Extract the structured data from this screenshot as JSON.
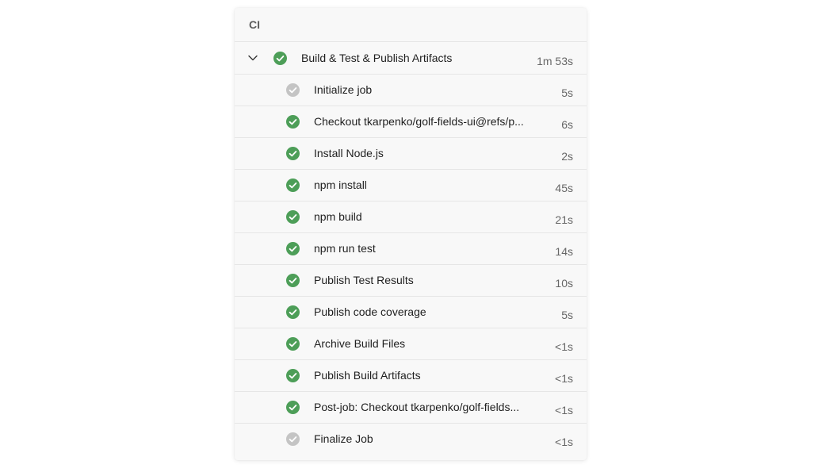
{
  "panel": {
    "title": "CI"
  },
  "colors": {
    "success": "#4d9e58",
    "neutral": "#c4c4c4"
  },
  "job": {
    "label": "Build & Test & Publish Artifacts",
    "duration": "1m 53s",
    "status": "success",
    "expanded": true,
    "icon": "chevron-down-icon"
  },
  "steps": [
    {
      "label": "Initialize job",
      "duration": "5s",
      "status": "neutral"
    },
    {
      "label": "Checkout tkarpenko/golf-fields-ui@refs/p...",
      "duration": "6s",
      "status": "success"
    },
    {
      "label": "Install Node.js",
      "duration": "2s",
      "status": "success"
    },
    {
      "label": "npm install",
      "duration": "45s",
      "status": "success"
    },
    {
      "label": "npm build",
      "duration": "21s",
      "status": "success"
    },
    {
      "label": "npm run test",
      "duration": "14s",
      "status": "success"
    },
    {
      "label": "Publish Test Results",
      "duration": "10s",
      "status": "success"
    },
    {
      "label": "Publish code coverage",
      "duration": "5s",
      "status": "success"
    },
    {
      "label": "Archive Build Files",
      "duration": "<1s",
      "status": "success"
    },
    {
      "label": "Publish Build Artifacts",
      "duration": "<1s",
      "status": "success"
    },
    {
      "label": "Post-job: Checkout tkarpenko/golf-fields...",
      "duration": "<1s",
      "status": "success"
    },
    {
      "label": "Finalize Job",
      "duration": "<1s",
      "status": "neutral"
    }
  ]
}
